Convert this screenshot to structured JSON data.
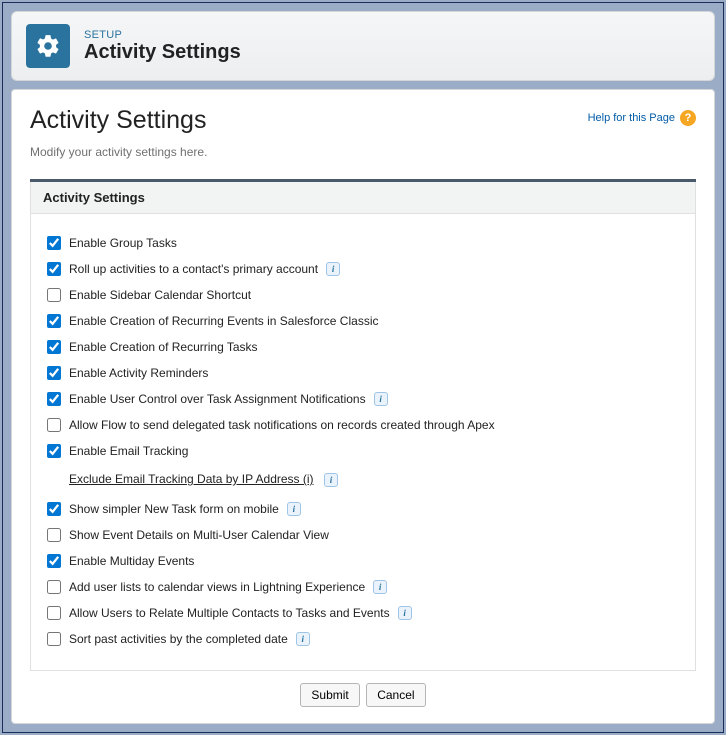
{
  "header": {
    "setup_label": "SETUP",
    "page_title": "Activity Settings"
  },
  "page": {
    "h1": "Activity Settings",
    "help_text": "Help for this Page",
    "subtext": "Modify your activity settings here."
  },
  "section": {
    "title": "Activity Settings"
  },
  "options": {
    "enable_group_tasks": {
      "label": "Enable Group Tasks",
      "checked": true,
      "info": false
    },
    "roll_up_activities": {
      "label": "Roll up activities to a contact's primary account",
      "checked": true,
      "info": true
    },
    "enable_sidebar_calendar": {
      "label": "Enable Sidebar Calendar Shortcut",
      "checked": false,
      "info": false
    },
    "enable_recurring_events": {
      "label": "Enable Creation of Recurring Events in Salesforce Classic",
      "checked": true,
      "info": false
    },
    "enable_recurring_tasks": {
      "label": "Enable Creation of Recurring Tasks",
      "checked": true,
      "info": false
    },
    "enable_activity_reminders": {
      "label": "Enable Activity Reminders",
      "checked": true,
      "info": false
    },
    "enable_user_control_task_notif": {
      "label": "Enable User Control over Task Assignment Notifications",
      "checked": true,
      "info": true
    },
    "allow_flow_delegated": {
      "label": "Allow Flow to send delegated task notifications on records created through Apex",
      "checked": false,
      "info": false
    },
    "enable_email_tracking": {
      "label": "Enable Email Tracking",
      "checked": true,
      "info": false
    },
    "exclude_email_tracking_link": {
      "label": "Exclude Email Tracking Data by IP Address (i)",
      "info": true
    },
    "show_simpler_task_form": {
      "label": "Show simpler New Task form on mobile",
      "checked": true,
      "info": true
    },
    "show_event_details_multi": {
      "label": "Show Event Details on Multi-User Calendar View",
      "checked": false,
      "info": false
    },
    "enable_multiday_events": {
      "label": "Enable Multiday Events",
      "checked": true,
      "info": false
    },
    "add_user_lists_calendar": {
      "label": "Add user lists to calendar views in Lightning Experience",
      "checked": false,
      "info": true
    },
    "allow_relate_multiple_contacts": {
      "label": "Allow Users to Relate Multiple Contacts to Tasks and Events",
      "checked": false,
      "info": true
    },
    "sort_past_activities": {
      "label": "Sort past activities by the completed date",
      "checked": false,
      "info": true
    }
  },
  "buttons": {
    "submit": "Submit",
    "cancel": "Cancel"
  }
}
